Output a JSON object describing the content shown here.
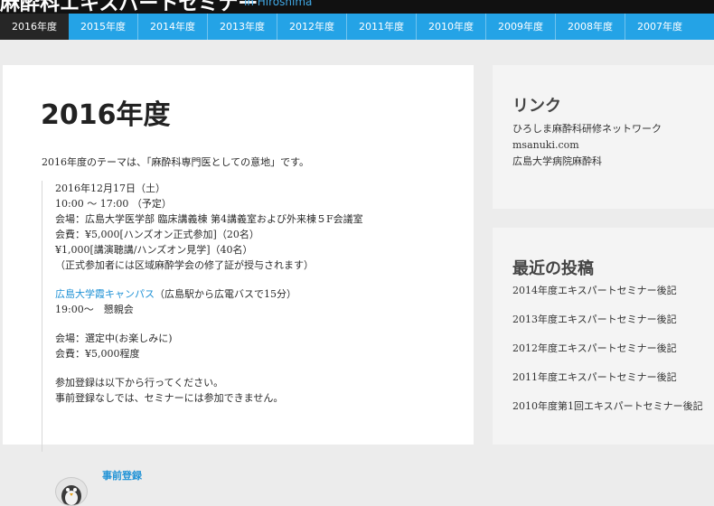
{
  "header": {
    "site_title": "麻酔科エキスパートセミナー",
    "site_subtitle": "in Hiroshima"
  },
  "nav": {
    "items": [
      "2016年度",
      "2015年度",
      "2014年度",
      "2013年度",
      "2012年度",
      "2011年度",
      "2010年度",
      "2009年度",
      "2008年度",
      "2007年度"
    ],
    "active_index": 0
  },
  "main": {
    "title": "2016年度",
    "intro": "2016年度のテーマは、「麻酔科専門医としての意地」です。",
    "date": "2016年12月17日（土）",
    "time": "10:00 〜 17:00 （予定）",
    "venue": "会場：広島大学医学部 臨床講義棟 第4講義室および外来棟５F会議室",
    "fee1": "会費：¥5,000[ハンズオン正式参加]（20名）",
    "fee2": "¥1,000[講演聴講/ハンズオン見学]（40名）",
    "note": "（正式参加者には区域麻酔学会の修了証が授与されます）",
    "campus_link": "広島大学霞キャンパス",
    "campus_note": "（広島駅から広電バスで15分）",
    "party_time": "19:00〜　懇親会",
    "party_venue": "会場：選定中(お楽しみに)",
    "party_fee": "会費：¥5,000程度",
    "registration_note1": "参加登録は以下から行ってください。",
    "registration_note2": "事前登録なしでは、セミナーには参加できません。",
    "registration_link": "事前登録"
  },
  "sidebar": {
    "links": {
      "title": "リンク",
      "items": [
        "ひろしま麻酔科研修ネットワーク",
        "msanuki.com",
        "広島大学病院麻酔科"
      ]
    },
    "recent": {
      "title": "最近の投稿",
      "items": [
        "2014年度エキスパートセミナー後記",
        "2013年度エキスパートセミナー後記",
        "2012年度エキスパートセミナー後記",
        "2011年度エキスパートセミナー後記",
        "2010年度第1回エキスパートセミナー後記"
      ]
    }
  },
  "colors": {
    "nav_bg": "#24a3e6",
    "nav_active": "#262626",
    "link": "#2293d6",
    "header_bg": "#111111"
  }
}
